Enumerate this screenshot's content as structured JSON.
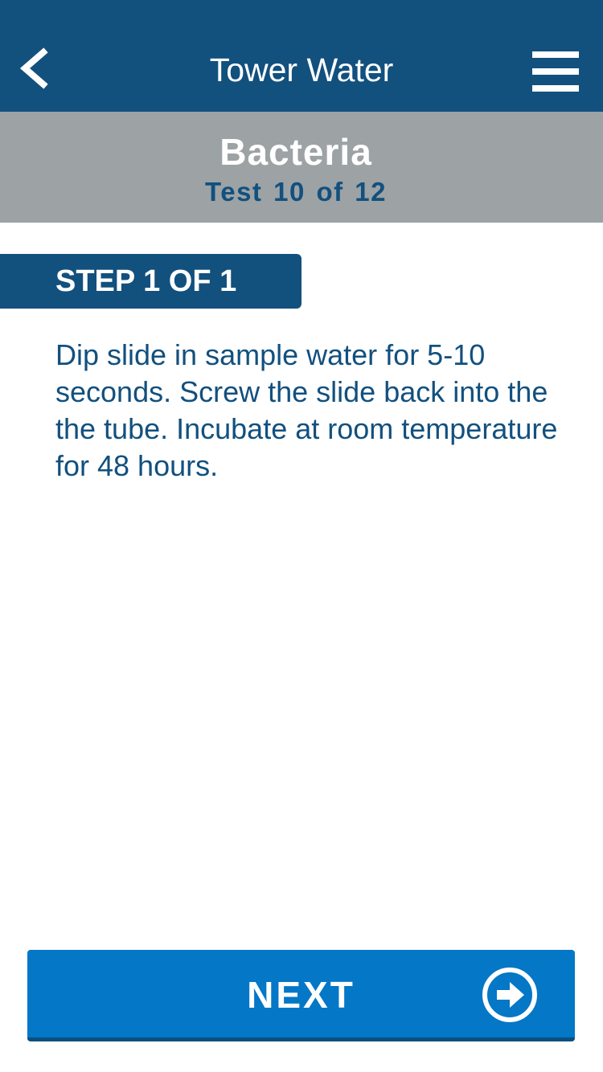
{
  "header": {
    "title": "Tower Water",
    "back_icon": "chevron-left-icon",
    "menu_icon": "hamburger-menu-icon",
    "background": "#12507e"
  },
  "test": {
    "name": "Bacteria",
    "progress": "Test 10 of 12",
    "background": "#9da2a4"
  },
  "step": {
    "label": "STEP 1 OF 1",
    "instructions": "Dip slide in sample water for 5-10 seconds. Screw the slide back into the the tube. Incubate at room temperature for 48 hours."
  },
  "footer": {
    "next_label": "NEXT",
    "next_icon": "circle-arrow-right-icon",
    "button_color": "#0477c7"
  }
}
